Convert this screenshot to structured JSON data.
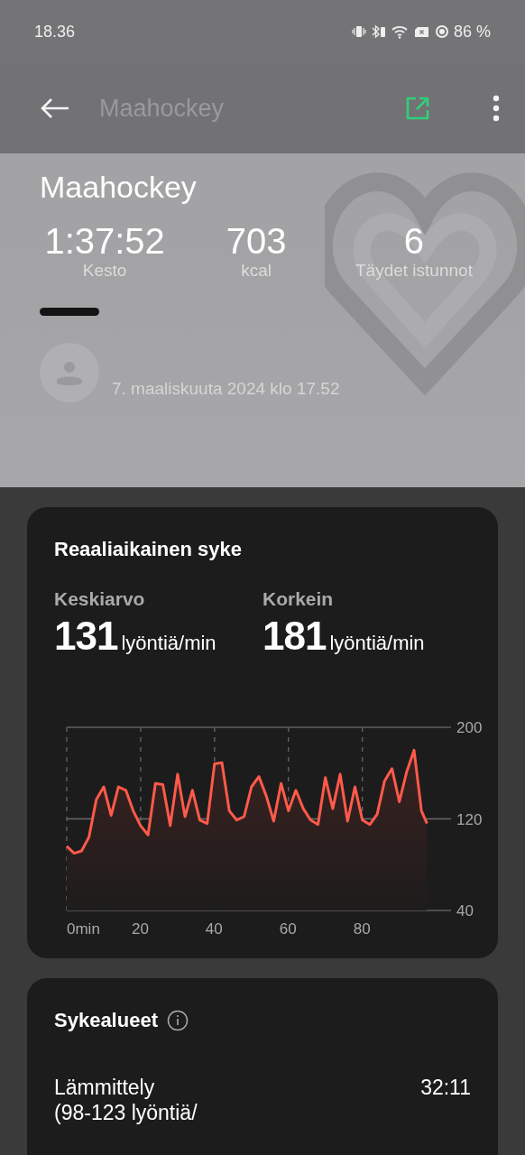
{
  "status_bar": {
    "time": "18.36",
    "battery": "86 %"
  },
  "app_bar": {
    "title": "Maahockey"
  },
  "summary": {
    "title": "Maahockey",
    "stats": [
      {
        "value": "1:37:52",
        "label": "Kesto"
      },
      {
        "value": "703",
        "label": "kcal"
      },
      {
        "value": "6",
        "label": "Täydet istunnot"
      }
    ],
    "date": "7. maaliskuuta 2024 klo 17.52"
  },
  "heart_rate_card": {
    "title": "Reaaliaikainen syke",
    "metrics": [
      {
        "label": "Keskiarvo",
        "value": "131",
        "unit": "lyöntiä/min"
      },
      {
        "label": "Korkein",
        "value": "181",
        "unit": "lyöntiä/min"
      }
    ],
    "chart_data": {
      "type": "area",
      "x": [
        0,
        2,
        4,
        6,
        8,
        10,
        12,
        14,
        16,
        18,
        20,
        22,
        24,
        26,
        28,
        30,
        32,
        34,
        36,
        38,
        40,
        42,
        44,
        46,
        48,
        50,
        52,
        54,
        56,
        58,
        60,
        62,
        64,
        66,
        68,
        70,
        72,
        74,
        76,
        78,
        80,
        82,
        84,
        86,
        88,
        90,
        92,
        94,
        96,
        97.5
      ],
      "series": [
        {
          "color": "#ff5a4a",
          "values": [
            96,
            90,
            92,
            104,
            137,
            148,
            123,
            148,
            145,
            127,
            114,
            106,
            151,
            150,
            114,
            159,
            122,
            145,
            119,
            116,
            168,
            169,
            127,
            119,
            122,
            148,
            157,
            140,
            118,
            151,
            127,
            145,
            129,
            119,
            115,
            156,
            129,
            159,
            118,
            148,
            119,
            115,
            124,
            153,
            164,
            135,
            161,
            180,
            127,
            116
          ]
        }
      ],
      "xlim": [
        0,
        104
      ],
      "ylim": [
        40,
        200
      ],
      "grid": true,
      "ref_lines": [
        {
          "axis": "y",
          "value": 120
        }
      ],
      "xticks": [
        {
          "value": 0,
          "label": "0min"
        },
        20,
        40,
        60,
        80
      ],
      "yticks": [
        40,
        120,
        200
      ]
    }
  },
  "zones_card": {
    "title": "Sykealueet",
    "zones": [
      {
        "name": "Lämmittely",
        "range": "(98-123 lyöntiä/",
        "time": "32:11"
      }
    ]
  }
}
